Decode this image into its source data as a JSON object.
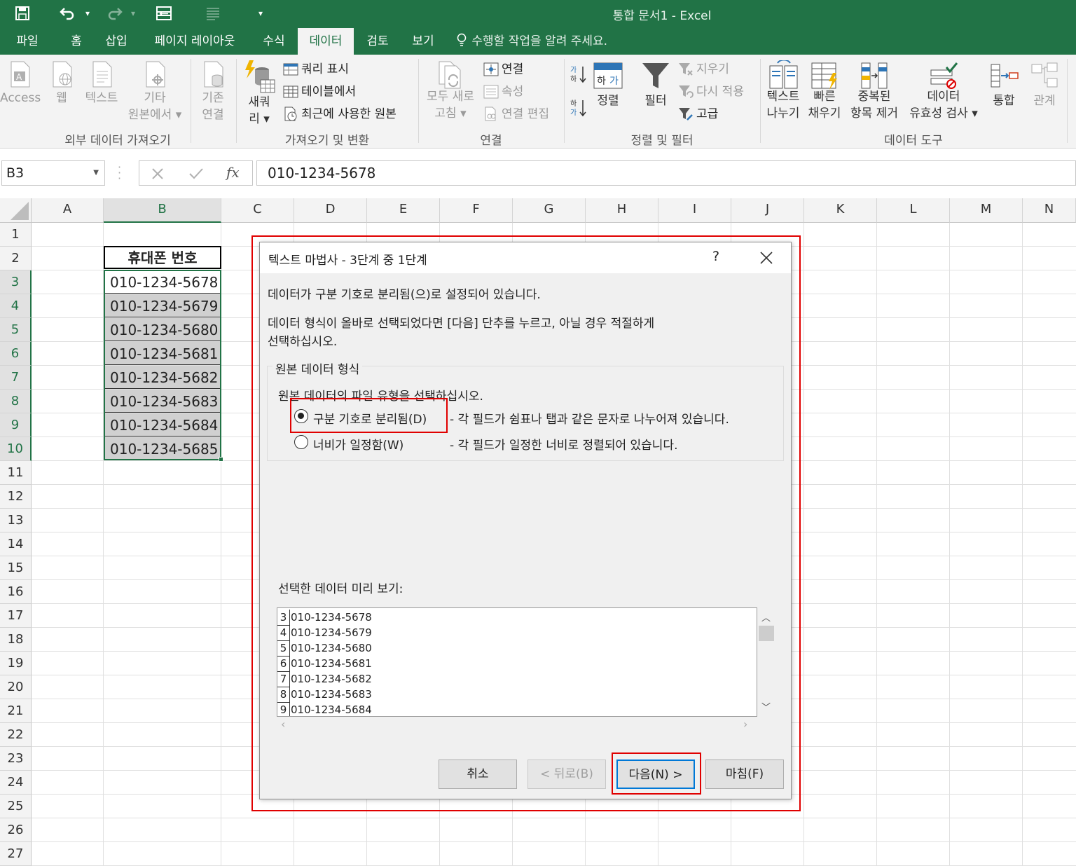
{
  "title_bar": {
    "document_title": "통합 문서1 - Excel"
  },
  "tabs": [
    "파일",
    "홈",
    "삽입",
    "페이지 레이아웃",
    "수식",
    "데이터",
    "검토",
    "보기"
  ],
  "active_tab": "데이터",
  "tell_me": "수행할 작업을 알려 주세요.",
  "ribbon": {
    "get_external": {
      "access": "Access",
      "web": "웹",
      "text": "텍스트",
      "other_1": "기타",
      "other_2": "원본에서 ▾",
      "existing_1": "기존",
      "existing_2": "연결",
      "label": "외부 데이터 가져오기"
    },
    "get_transform": {
      "new_query_1": "새쿼",
      "new_query_2": "리 ▾",
      "show_queries": "쿼리 표시",
      "from_table": "테이블에서",
      "recent_sources": "최근에 사용한 원본",
      "label": "가져오기 및 변환"
    },
    "connections": {
      "refresh_1": "모두 새로",
      "refresh_2": "고침 ▾",
      "connections": "연결",
      "properties": "속성",
      "edit_links": "연결 편집",
      "label": "연결"
    },
    "sort_filter": {
      "sort": "정렬",
      "filter": "필터",
      "clear": "지우기",
      "reapply": "다시 적용",
      "advanced": "고급",
      "label": "정렬 및 필터"
    },
    "data_tools": {
      "text_to_columns_1": "텍스트",
      "text_to_columns_2": "나누기",
      "flash_fill_1": "빠른",
      "flash_fill_2": "채우기",
      "remove_dup_1": "중복된",
      "remove_dup_2": "항목 제거",
      "validation_1": "데이터",
      "validation_2": "유효성 검사 ▾",
      "consolidate": "통합",
      "relationships": "관계",
      "label": "데이터 도구"
    }
  },
  "formula_bar": {
    "name_box": "B3",
    "formula": "010-1234-5678"
  },
  "columns": [
    "A",
    "B",
    "C",
    "D",
    "E",
    "F",
    "G",
    "H",
    "I",
    "J",
    "K",
    "L",
    "M",
    "N"
  ],
  "rows": [
    "1",
    "2",
    "3",
    "4",
    "5",
    "6",
    "7",
    "8",
    "9",
    "10",
    "11",
    "12",
    "13",
    "14",
    "15",
    "16",
    "17",
    "18",
    "19",
    "20",
    "21",
    "22",
    "23",
    "24",
    "25",
    "26",
    "27"
  ],
  "sheet": {
    "header": "휴대폰 번호",
    "values": [
      "010-1234-5678",
      "010-1234-5679",
      "010-1234-5680",
      "010-1234-5681",
      "010-1234-5682",
      "010-1234-5683",
      "010-1234-5684",
      "010-1234-5685"
    ]
  },
  "dialog": {
    "title": "텍스트 마법사 - 3단계 중 1단계",
    "help": "?",
    "line1": "데이터가 구분 기호로 분리됨(으)로 설정되어 있습니다.",
    "line2a": "데이터 형식이 올바로 선택되었다면 [다음] 단추를 누르고, 아닐 경우 적절하게",
    "line2b": "선택하십시오.",
    "group_label": "원본 데이터 형식",
    "group_prompt": "원본 데이터의 파일 유형을 선택하십시오.",
    "opt_delimited": "구분 기호로 분리됨(D)",
    "opt_delimited_desc": "- 각 필드가 쉼표나 탭과 같은 문자로 나누어져 있습니다.",
    "opt_fixed": "너비가 일정함(W)",
    "opt_fixed_desc": "- 각 필드가 일정한 너비로 정렬되어 있습니다.",
    "preview_label": "선택한 데이터 미리 보기:",
    "preview_rows": [
      {
        "n": "3",
        "v": "010-1234-5678"
      },
      {
        "n": "4",
        "v": "010-1234-5679"
      },
      {
        "n": "5",
        "v": "010-1234-5680"
      },
      {
        "n": "6",
        "v": "010-1234-5681"
      },
      {
        "n": "7",
        "v": "010-1234-5682"
      },
      {
        "n": "8",
        "v": "010-1234-5683"
      },
      {
        "n": "9",
        "v": "010-1234-5684"
      }
    ],
    "btn_cancel": "취소",
    "btn_back": "< 뒤로(B)",
    "btn_next": "다음(N) >",
    "btn_finish": "마침(F)"
  }
}
